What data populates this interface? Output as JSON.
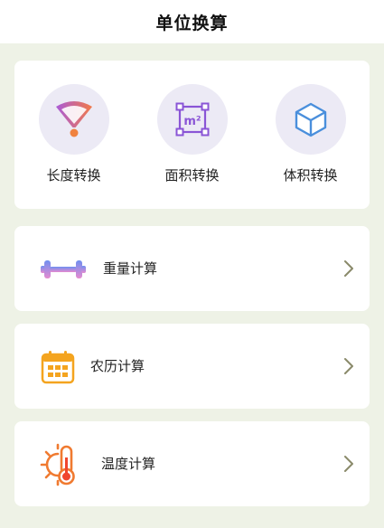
{
  "header": {
    "title": "单位换算"
  },
  "conversions": [
    {
      "label": "长度转换",
      "icon": "fan-ruler-icon"
    },
    {
      "label": "面积转换",
      "icon": "area-m2-icon"
    },
    {
      "label": "体积转换",
      "icon": "cube-icon"
    }
  ],
  "calculators": [
    {
      "label": "重量计算",
      "icon": "dumbbell-icon"
    },
    {
      "label": "农历计算",
      "icon": "calendar-icon"
    },
    {
      "label": "温度计算",
      "icon": "thermometer-sun-icon"
    }
  ],
  "area_icon_text": "m²",
  "colors": {
    "background": "#eef2e6",
    "card": "#ffffff",
    "icon_circle": "#eceaf5",
    "chevron": "#8a8a6a"
  }
}
